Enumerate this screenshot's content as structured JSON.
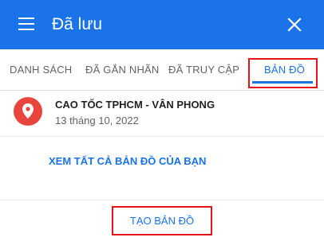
{
  "header": {
    "title": "Đã lưu",
    "menu_icon": "hamburger-menu-icon",
    "close_icon": "close-icon"
  },
  "tabs": [
    {
      "label": "DANH SÁCH",
      "active": false
    },
    {
      "label": "ĐÃ GẮN NHÃN",
      "active": false
    },
    {
      "label": "ĐÃ TRUY CẬP",
      "active": false
    },
    {
      "label": "BẢN ĐỒ",
      "active": true
    }
  ],
  "maps": [
    {
      "title": "CAO TỐC TPHCM - VÂN PHONG",
      "date": "13 tháng 10, 2022",
      "icon": "map-pin-icon"
    }
  ],
  "links": {
    "see_all": "XEM TẤT CẢ BẢN ĐỒ CỦA BẠN",
    "create_map": "TẠO BẢN ĐỒ"
  },
  "colors": {
    "header_bg": "#1a73e8",
    "accent": "#1a73e8",
    "pin_bg": "#e8453c",
    "highlight": "#e3151a"
  }
}
